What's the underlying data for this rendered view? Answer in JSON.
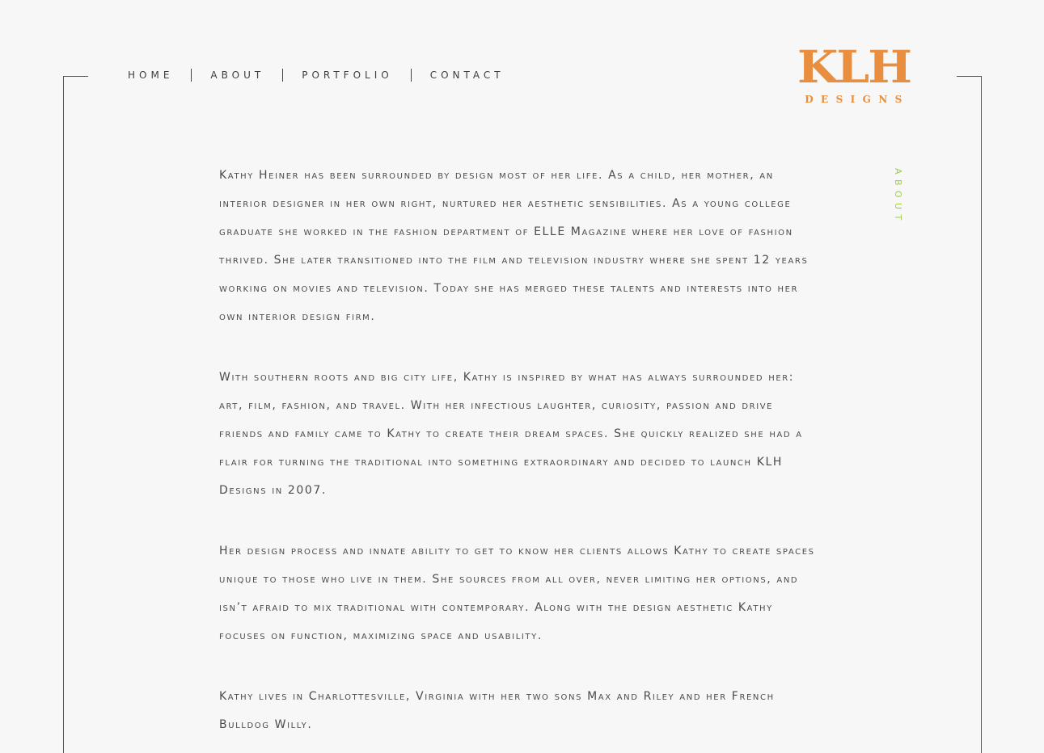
{
  "nav": {
    "items": [
      {
        "label": "HOME"
      },
      {
        "label": "ABOUT"
      },
      {
        "label": "PORTFOLIO"
      },
      {
        "label": "CONTACT"
      }
    ]
  },
  "logo": {
    "main": "KLH",
    "sub": "DESIGNS",
    "color": "#e88e3e"
  },
  "section_label": "ABOUT",
  "section_label_color": "#9ccf3a",
  "paragraphs": [
    "Kathy Heiner has been surrounded by design most of her life. As a child, her mother, an interior designer in her own right, nurtured her aesthetic sensibilities. As a young college graduate she worked in the fashion department of ELLE Magazine where her love of fashion thrived. She later transitioned into the film and television industry where she spent 12 years working on movies and television. Today she has merged these talents and interests into her own interior design firm.",
    "With southern roots and big city life, Kathy is inspired by what has always surrounded her: art, film, fashion, and travel. With her infectious laughter, curiosity, passion and drive friends and family came to Kathy to create their dream spaces. She quickly realized she had a flair for turning the traditional into something extraordinary and decided to launch KLH Designs in 2007.",
    "Her design process and innate ability to get to know her clients allows Kathy to create spaces unique to those who live in them. She sources from all over, never limiting her options, and isn’t afraid to mix traditional with contemporary. Along with the design aesthetic Kathy focuses on function, maximizing space and usability.",
    "Kathy lives in Charlottesville, Virginia with her two sons Max and Riley and her French Bulldog Willy."
  ]
}
